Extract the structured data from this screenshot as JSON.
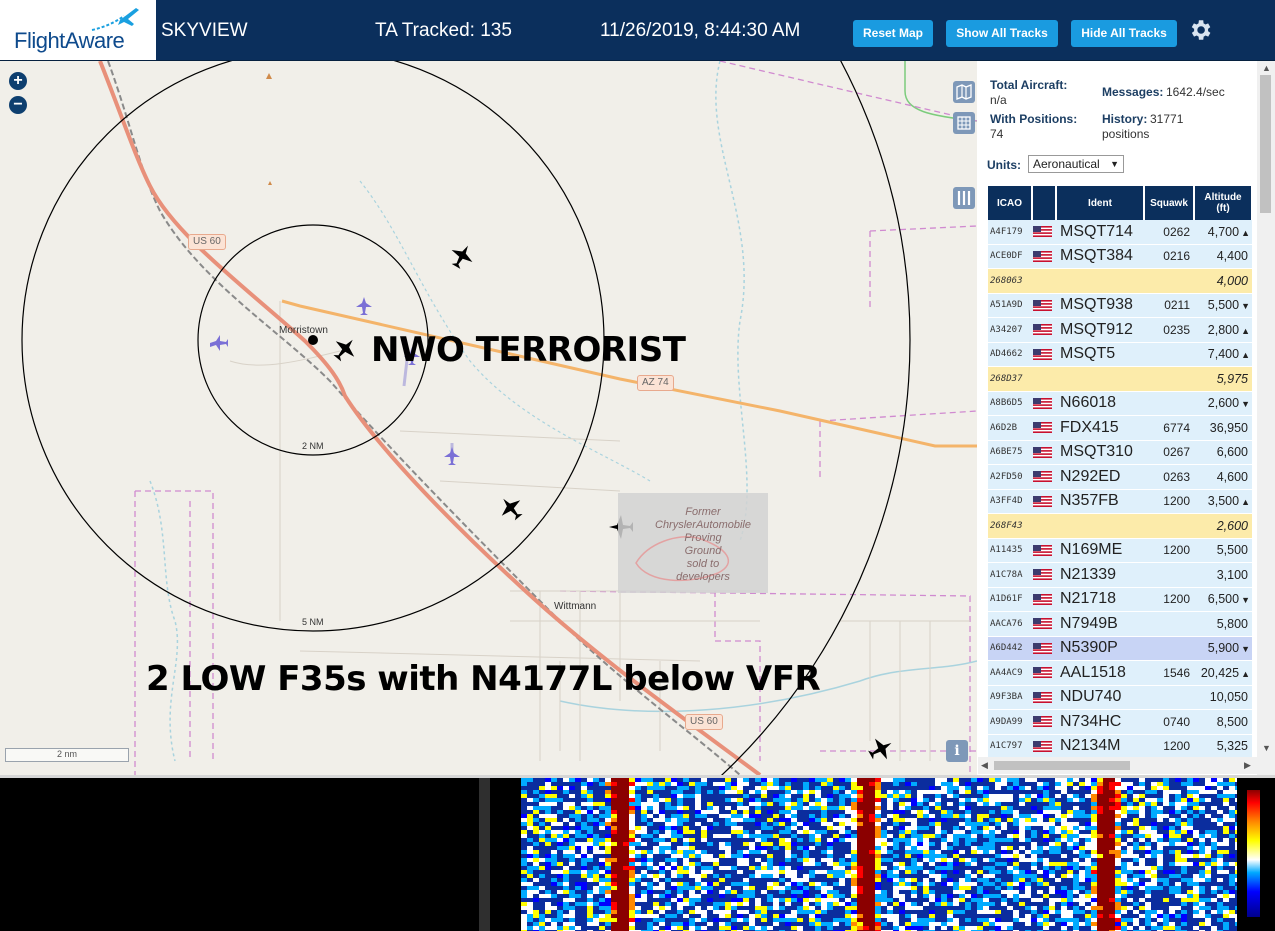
{
  "header": {
    "logo_text": "FlightAware",
    "app_title": "SKYVIEW",
    "ta_tracked": "TA Tracked: 135",
    "datetime": "11/26/2019, 8:44:30 AM",
    "buttons": {
      "reset_map": "Reset Map",
      "show_all_tracks": "Show All Tracks",
      "hide_all_tracks": "Hide All Tracks"
    },
    "settings_icon": "gear-icon"
  },
  "map": {
    "zoom_in": "+",
    "zoom_out": "−",
    "scale_bar": "2 nm",
    "info_button": "i",
    "places": {
      "morristown": "Morristown",
      "wittmann": "Wittmann"
    },
    "roads": {
      "us60_north": "US 60",
      "az74": "AZ 74",
      "us60_south": "US 60"
    },
    "rings": {
      "inner": "2 NM",
      "outer": "5 NM"
    },
    "proving_ground": [
      "Former",
      "ChryslerAutomobile",
      "Proving",
      "Ground",
      "sold to",
      "developers"
    ],
    "overlay_text_1": "NWO TERRORIST",
    "overlay_text_2": "2 LOW F35s with N4177L below VFR",
    "colors": {
      "land": "#f1efe9",
      "highway": "#e8907a",
      "state_route": "#f4b46a",
      "restricted": "#d08ad0",
      "water": "#a9d3de",
      "aircraft_tracked": "#000000",
      "aircraft_untracked": "#7b70d6"
    }
  },
  "panel": {
    "total_aircraft_label": "Total Aircraft:",
    "total_aircraft_value": "n/a",
    "messages_label": "Messages:",
    "messages_value": "1642.4/sec",
    "with_positions_label": "With Positions:",
    "with_positions_value": "74",
    "history_label": "History:",
    "history_value": "31771",
    "history_unit": "positions",
    "units_label": "Units:",
    "units_value": "Aeronautical",
    "columns": {
      "icao": "ICAO",
      "flag": "",
      "ident": "Ident",
      "squawk": "Squawk",
      "altitude": "Altitude",
      "altitude_unit": "(ft)"
    },
    "rows": [
      {
        "icao": "A4F179",
        "flag": true,
        "ident": "MSQT714",
        "squawk": "0262",
        "alt": "4,700",
        "trend": "▲",
        "style": ""
      },
      {
        "icao": "ACE0DF",
        "flag": true,
        "ident": "MSQT384",
        "squawk": "0216",
        "alt": "4,400",
        "trend": "",
        "style": ""
      },
      {
        "icao": "268063",
        "flag": false,
        "ident": "",
        "squawk": "",
        "alt": "4,000",
        "trend": "",
        "style": "hl"
      },
      {
        "icao": "A51A9D",
        "flag": true,
        "ident": "MSQT938",
        "squawk": "0211",
        "alt": "5,500",
        "trend": "▼",
        "style": ""
      },
      {
        "icao": "A34207",
        "flag": true,
        "ident": "MSQT912",
        "squawk": "0235",
        "alt": "2,800",
        "trend": "▲",
        "style": ""
      },
      {
        "icao": "AD4662",
        "flag": true,
        "ident": "MSQT5",
        "squawk": "",
        "alt": "7,400",
        "trend": "▲",
        "style": ""
      },
      {
        "icao": "268D37",
        "flag": false,
        "ident": "",
        "squawk": "",
        "alt": "5,975",
        "trend": "",
        "style": "hl"
      },
      {
        "icao": "A8B6D5",
        "flag": true,
        "ident": "N66018",
        "squawk": "",
        "alt": "2,600",
        "trend": "▼",
        "style": ""
      },
      {
        "icao": "A6D2B",
        "flag": true,
        "ident": "FDX415",
        "squawk": "6774",
        "alt": "36,950",
        "trend": "",
        "style": ""
      },
      {
        "icao": "A6BE75",
        "flag": true,
        "ident": "MSQT310",
        "squawk": "0267",
        "alt": "6,600",
        "trend": "",
        "style": ""
      },
      {
        "icao": "A2FD50",
        "flag": true,
        "ident": "N292ED",
        "squawk": "0263",
        "alt": "4,600",
        "trend": "",
        "style": ""
      },
      {
        "icao": "A3FF4D",
        "flag": true,
        "ident": "N357FB",
        "squawk": "1200",
        "alt": "3,500",
        "trend": "▲",
        "style": ""
      },
      {
        "icao": "268F43",
        "flag": false,
        "ident": "",
        "squawk": "",
        "alt": "2,600",
        "trend": "",
        "style": "hl"
      },
      {
        "icao": "A11435",
        "flag": true,
        "ident": "N169ME",
        "squawk": "1200",
        "alt": "5,500",
        "trend": "",
        "style": ""
      },
      {
        "icao": "A1C78A",
        "flag": true,
        "ident": "N21339",
        "squawk": "",
        "alt": "3,100",
        "trend": "",
        "style": ""
      },
      {
        "icao": "A1D61F",
        "flag": true,
        "ident": "N21718",
        "squawk": "1200",
        "alt": "6,500",
        "trend": "▼",
        "style": ""
      },
      {
        "icao": "AACA76",
        "flag": true,
        "ident": "N7949B",
        "squawk": "",
        "alt": "5,800",
        "trend": "",
        "style": ""
      },
      {
        "icao": "A6D442",
        "flag": true,
        "ident": "N5390P",
        "squawk": "",
        "alt": "5,900",
        "trend": "▼",
        "style": "sel"
      },
      {
        "icao": "AA4AC9",
        "flag": true,
        "ident": "AAL1518",
        "squawk": "1546",
        "alt": "20,425",
        "trend": "▲",
        "style": ""
      },
      {
        "icao": "A9F3BA",
        "flag": true,
        "ident": "NDU740",
        "squawk": "",
        "alt": "10,050",
        "trend": "",
        "style": ""
      },
      {
        "icao": "A9DA99",
        "flag": true,
        "ident": "N734HC",
        "squawk": "0740",
        "alt": "8,500",
        "trend": "",
        "style": ""
      },
      {
        "icao": "A1C797",
        "flag": true,
        "ident": "N2134M",
        "squawk": "1200",
        "alt": "5,325",
        "trend": "",
        "style": ""
      }
    ]
  },
  "spectrogram": {
    "colormap": [
      "#00008b",
      "#0000ff",
      "#00aaff",
      "#ffffff",
      "#ffff00",
      "#ff8800",
      "#ff0000",
      "#8b0000"
    ]
  }
}
